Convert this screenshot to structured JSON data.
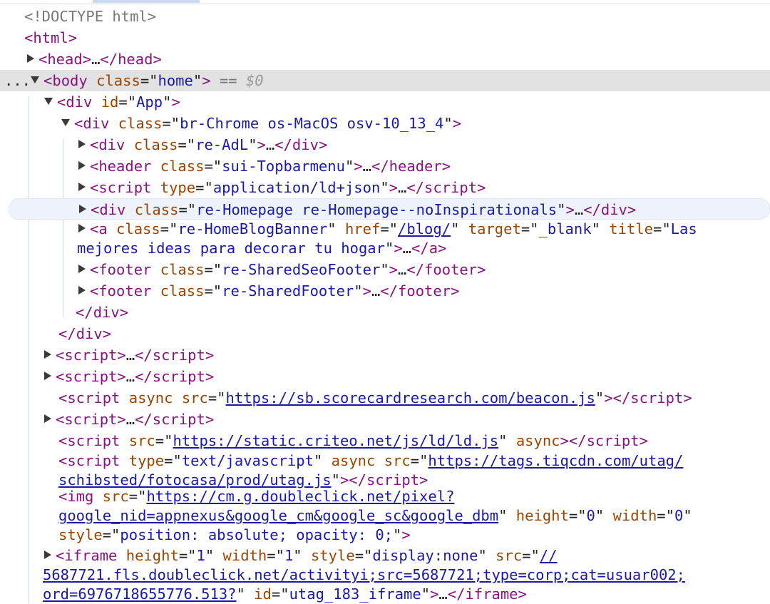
{
  "lines": [
    {
      "kind": "doctype",
      "text": "<!DOCTYPE html>"
    },
    {
      "kind": "open",
      "tag": "html"
    },
    {
      "kind": "collapsed",
      "tag": "head"
    },
    {
      "kind": "body",
      "tag": "body",
      "attr": "class",
      "value": "home",
      "suffix": " == ",
      "var": "$0",
      "gutter": "..."
    },
    {
      "kind": "expanded",
      "tag": "div",
      "attr": "id",
      "value": "App"
    },
    {
      "kind": "expanded",
      "tag": "div",
      "attr": "class",
      "value": "br-Chrome os-MacOS osv-10_13_4"
    },
    {
      "kind": "collapsed",
      "tag": "div",
      "attr": "class",
      "value": "re-AdL"
    },
    {
      "kind": "collapsed",
      "tag": "header",
      "attr": "class",
      "value": "sui-Topbarmenu"
    },
    {
      "kind": "collapsed",
      "tag": "script",
      "attr": "type",
      "value": "application/ld+json"
    },
    {
      "kind": "collapsed",
      "tag": "div",
      "attr": "class",
      "value": "re-Homepage re-Homepage--noInspirationals"
    },
    {
      "kind": "anchor",
      "tag": "a",
      "attrs": [
        {
          "name": "class",
          "value": "re-HomeBlogBanner"
        },
        {
          "name": "href",
          "value": "/blog/"
        },
        {
          "name": "target",
          "value": "_blank"
        },
        {
          "name": "title",
          "value": "Las mejores ideas para decorar tu hogar"
        }
      ]
    },
    {
      "kind": "collapsed",
      "tag": "footer",
      "attr": "class",
      "value": "re-SharedSeoFooter"
    },
    {
      "kind": "collapsed",
      "tag": "footer",
      "attr": "class",
      "value": "re-SharedFooter"
    },
    {
      "kind": "close",
      "tag": "div"
    },
    {
      "kind": "close",
      "tag": "div"
    },
    {
      "kind": "collapsed",
      "tag": "script"
    },
    {
      "kind": "collapsed",
      "tag": "script"
    },
    {
      "kind": "script-src",
      "tag": "script",
      "pre_attr": "async",
      "attr": "src",
      "value": "https://sb.scorecardresearch.com/beacon.js"
    },
    {
      "kind": "collapsed",
      "tag": "script"
    },
    {
      "kind": "script-src2",
      "tag": "script",
      "attr": "src",
      "value": "https://static.criteo.net/js/ld/ld.js",
      "post_attr": "async"
    },
    {
      "kind": "script-type",
      "tag": "script",
      "attr1": "type",
      "value1": "text/javascript",
      "flag": "async",
      "attr2": "src",
      "url_line1": "https://tags.tiqcdn.com/utag/",
      "url_line2": "schibsted/fotocasa/prod/utag.js"
    },
    {
      "kind": "img",
      "tag": "img",
      "url_line1": "https://cm.g.doubleclick.net/pixel?",
      "url_line2": "google_nid=appnexus&google_cm&google_sc&google_dbm",
      "height": "0",
      "width": "0",
      "style": "position: absolute; opacity: 0;"
    },
    {
      "kind": "iframe",
      "tag": "iframe",
      "height": "1",
      "width": "1",
      "style": "display:none",
      "src_line1": "//",
      "src_line2": "5687721.fls.doubleclick.net/activityi;src=5687721;type=corp;cat=usuar002;",
      "src_line3": "ord=6976718655776.513?",
      "id": "utag_183_iframe"
    }
  ],
  "ellipsis": "…",
  "icons": {
    "collapsed": "triangle-right-icon",
    "expanded": "triangle-down-icon"
  },
  "colors": {
    "tag": "#881280",
    "attr_name": "#994500",
    "attr_value": "#1a1aa6",
    "selection": "#e2e2e2",
    "hover": "#eef3fb"
  }
}
